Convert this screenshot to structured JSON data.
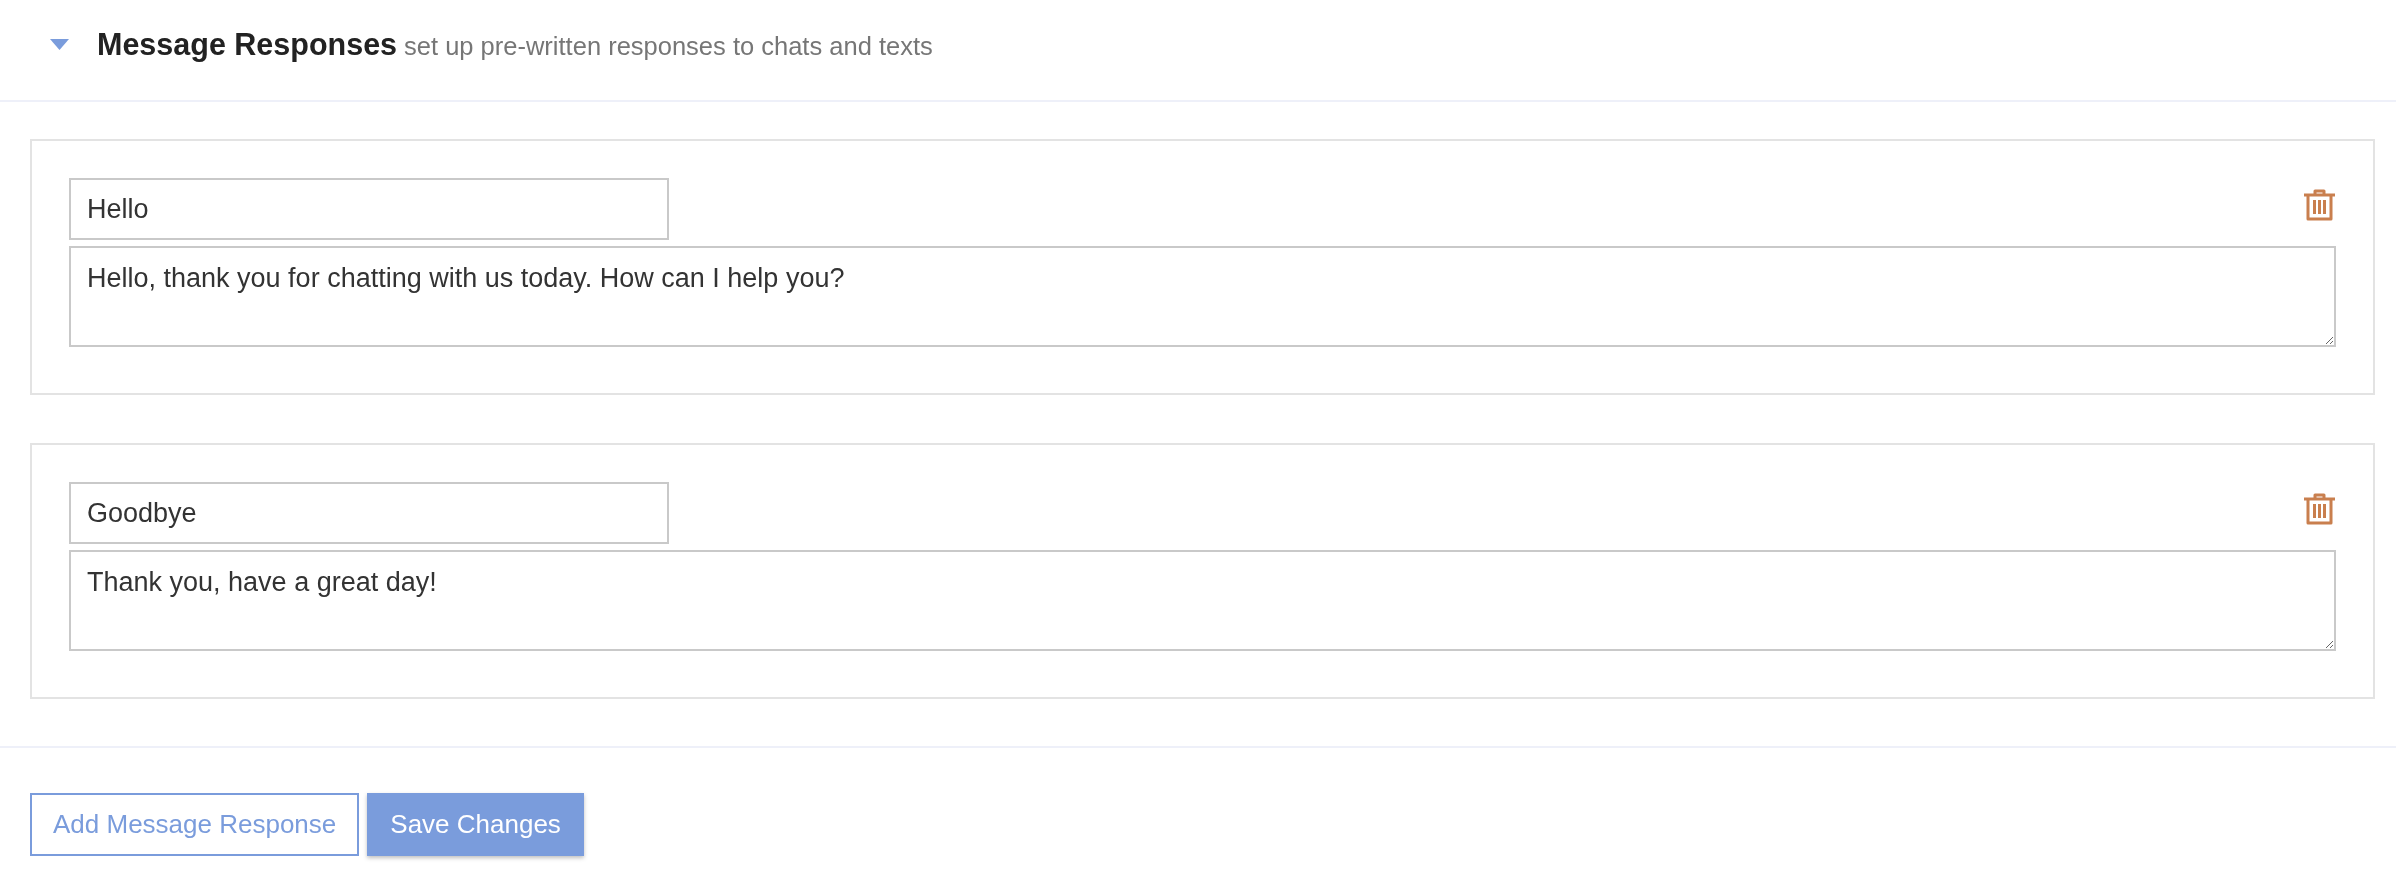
{
  "section": {
    "expanded": true,
    "title": "Message Responses",
    "subtitle": "set up pre-written responses to chats and texts"
  },
  "responses": [
    {
      "name": "Hello",
      "message": "Hello, thank you for chatting with us today. How can I help you?"
    },
    {
      "name": "Goodbye",
      "message": "Thank you, have a great day!"
    }
  ],
  "buttons": [
    {
      "kind": "outline",
      "label": "Add Message Response"
    },
    {
      "kind": "primary",
      "label": "Save Changes"
    }
  ]
}
